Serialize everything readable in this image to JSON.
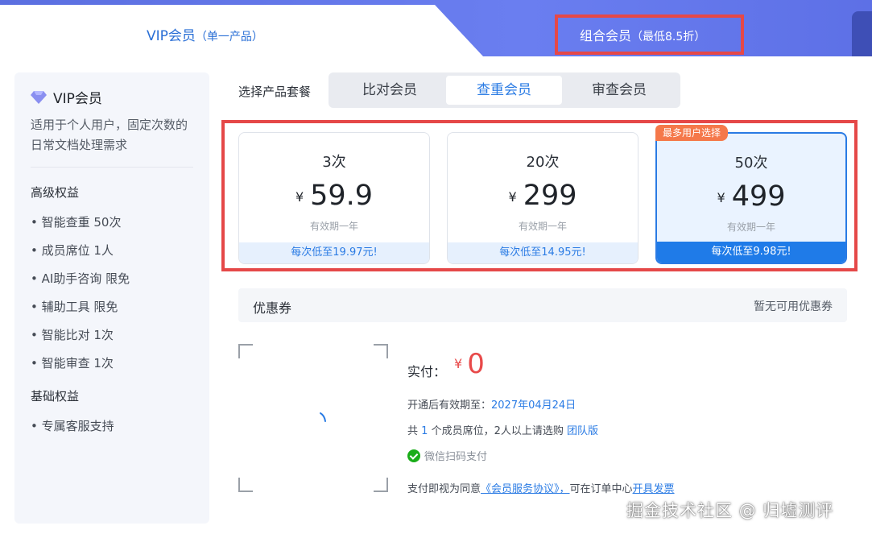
{
  "tabs": {
    "vip": {
      "label": "VIP会员",
      "sub": "（单一产品）"
    },
    "combo": {
      "label": "组合会员",
      "sub": "（最低8.5折）"
    }
  },
  "sidebar": {
    "title": "VIP会员",
    "desc": "适用于个人用户，固定次数的日常文档处理需求",
    "advanced_title": "高级权益",
    "advanced_items": [
      "• 智能查重 50次",
      "• 成员席位 1人",
      "• AI助手咨询 限免",
      "• 辅助工具 限免",
      "• 智能比对 1次",
      "• 智能审查 1次"
    ],
    "basic_title": "基础权益",
    "basic_items": [
      "• 专属客服支持"
    ]
  },
  "product_selector": {
    "label": "选择产品套餐",
    "options": [
      "比对会员",
      "查重会员",
      "审查会员"
    ],
    "selected": "查重会员"
  },
  "plans": [
    {
      "count": "3次",
      "yen": "¥",
      "price": "59.9",
      "validity": "有效期一年",
      "per_use": "每次低至19.97元!"
    },
    {
      "count": "20次",
      "yen": "¥",
      "price": "299",
      "validity": "有效期一年",
      "per_use": "每次低至14.95元!"
    },
    {
      "count": "50次",
      "yen": "¥",
      "price": "499",
      "validity": "有效期一年",
      "per_use": "每次低至9.98元!",
      "badge": "最多用户选择"
    }
  ],
  "coupon": {
    "label": "优惠券",
    "status": "暂无可用优惠券"
  },
  "payment": {
    "label": "实付：",
    "yen": "¥",
    "amount": "0",
    "valid_prefix": "开通后有效期至：",
    "valid_date": "2027年04月24日",
    "seats_prefix": "共",
    "seats_count": "1",
    "seats_mid": "个成员席位，2人以上请选购",
    "team_link": "团队版",
    "wechat_label": "微信扫码支付",
    "agree_prefix": "支付即视为同意",
    "agreement_link": "《会员服务协议》，",
    "invoice_prefix": "可在订单中心",
    "invoice_link": "开具发票"
  },
  "watermark": "掘金技术社区 @ 归墟测评",
  "colors": {
    "accent": "#2a7be4",
    "highlight_frame": "#e54848",
    "badge": "#f5784a",
    "price_red": "#e84a4a"
  }
}
